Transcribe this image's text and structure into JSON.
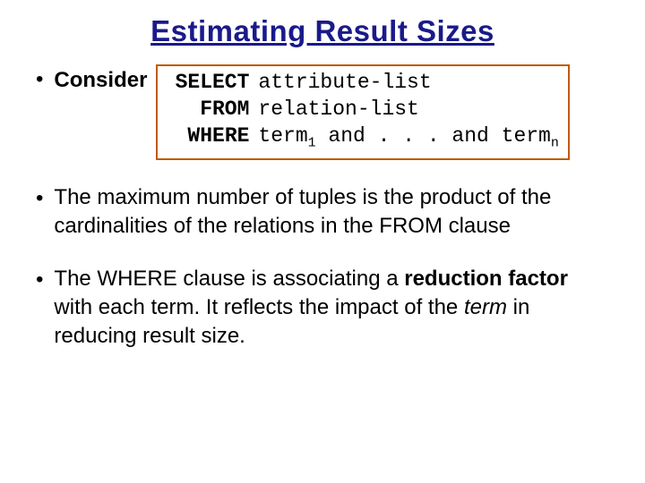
{
  "title": "Estimating Result Sizes",
  "bullets": {
    "consider_label": "Consider",
    "sql": {
      "kw_select": "SELECT",
      "arg_select": "attribute-list",
      "kw_from": "FROM",
      "arg_from": "relation-list",
      "kw_where": "WHERE",
      "arg_where_pre": "term",
      "arg_where_sub1": "1",
      "arg_where_mid": " and . . . and term",
      "arg_where_subn": "n"
    },
    "b2_a": "The maximum number of tuples is the product of the cardinalities of the relations in the FROM clause",
    "b3_a": "The WHERE clause is associating a ",
    "b3_bold": "reduction factor",
    "b3_b": " with each term. It reflects the impact of the ",
    "b3_emph": "term",
    "b3_c": " in reducing result size."
  }
}
